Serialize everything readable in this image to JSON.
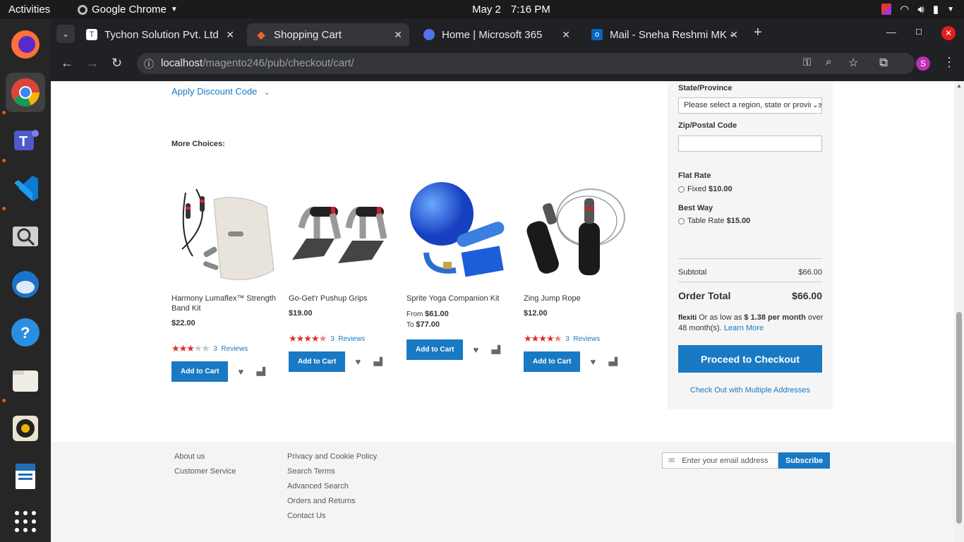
{
  "system": {
    "activities": "Activities",
    "app_name": "Google Chrome",
    "date": "May 2",
    "time": "7:16 PM"
  },
  "browser": {
    "tabs": [
      {
        "title": "Tychon Solution Pvt. Ltd"
      },
      {
        "title": "Shopping Cart"
      },
      {
        "title": "Home | Microsoft 365"
      },
      {
        "title": "Mail - Sneha Reshmi MK -"
      }
    ],
    "url_host": "localhost",
    "url_path": "/magento246/pub/checkout/cart/",
    "profile_initial": "S"
  },
  "cart": {
    "discount_label": "Apply Discount Code",
    "more_choices": "More Choices:",
    "products": [
      {
        "name": "Harmony Lumaflex™ Strength Band Kit",
        "price": "$22.00",
        "rating": 3,
        "reviews": "3",
        "reviews_label": "Reviews",
        "add_label": "Add to Cart"
      },
      {
        "name": "Go-Get'r Pushup Grips",
        "price": "$19.00",
        "rating": 4.5,
        "reviews": "3",
        "reviews_label": "Reviews",
        "add_label": "Add to Cart"
      },
      {
        "name": "Sprite Yoga Companion Kit",
        "from_label": "From",
        "from_price": "$61.00",
        "to_label": "To",
        "to_price": "$77.00",
        "add_label": "Add to Cart"
      },
      {
        "name": "Zing Jump Rope",
        "price": "$12.00",
        "rating": 4.5,
        "reviews": "3",
        "reviews_label": "Reviews",
        "add_label": "Add to Cart"
      }
    ]
  },
  "summary": {
    "state_label": "State/Province",
    "state_placeholder": "Please select a region, state or province.",
    "zip_label": "Zip/Postal Code",
    "flat_rate_title": "Flat Rate",
    "flat_rate_option": "Fixed",
    "flat_rate_price": "$10.00",
    "best_way_title": "Best Way",
    "best_way_option": "Table Rate",
    "best_way_price": "$15.00",
    "subtotal_label": "Subtotal",
    "subtotal_value": "$66.00",
    "order_total_label": "Order Total",
    "order_total_value": "$66.00",
    "flexiti_logo": "flexiti",
    "flexiti_text_1": "Or as low as",
    "flexiti_amount": "$ 1.38 per month",
    "flexiti_text_2": "over 48 month(s).",
    "learn_more": "Learn More",
    "checkout_button": "Proceed to Checkout",
    "multi_address": "Check Out with Multiple Addresses"
  },
  "footer": {
    "col1": [
      "About us",
      "Customer Service"
    ],
    "col2": [
      "Privacy and Cookie Policy",
      "Search Terms",
      "Advanced Search",
      "Orders and Returns",
      "Contact Us"
    ],
    "email_placeholder": "Enter your email address",
    "subscribe": "Subscribe"
  },
  "colors": {
    "accent": "#1979c3",
    "star": "#e02b27"
  }
}
